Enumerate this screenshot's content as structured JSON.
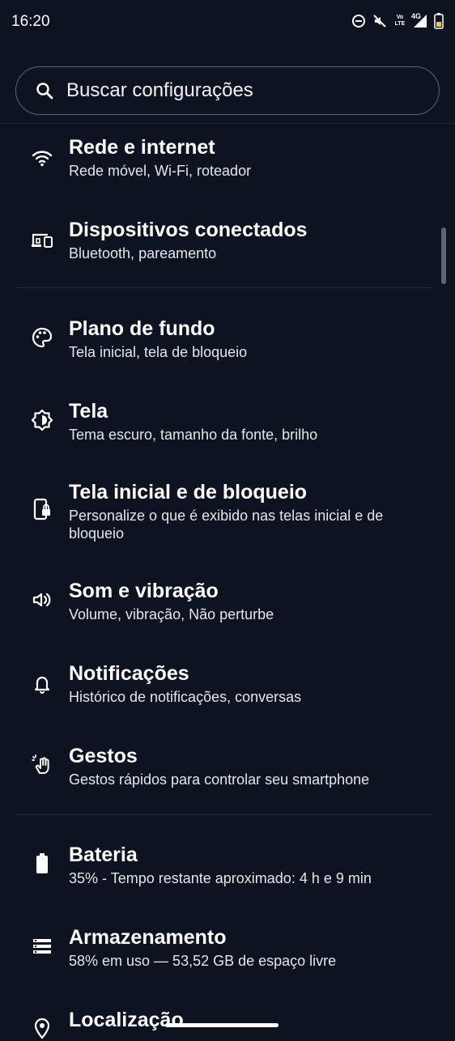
{
  "status_bar": {
    "time": "16:20",
    "icons": [
      "do-not-disturb-icon",
      "muted-icon",
      "volte-icon",
      "4g-signal-icon",
      "battery-icon"
    ],
    "volte_label": "Vo LTE",
    "network_label": "4G"
  },
  "search": {
    "placeholder": "Buscar configurações"
  },
  "settings": [
    {
      "icon": "wifi-icon",
      "title": "Rede e internet",
      "subtitle": "Rede móvel, Wi-Fi, roteador"
    },
    {
      "icon": "connected-devices-icon",
      "title": "Dispositivos conectados",
      "subtitle": "Bluetooth, pareamento"
    },
    {
      "icon": "palette-icon",
      "title": "Plano de fundo",
      "subtitle": "Tela inicial, tela de bloqueio"
    },
    {
      "icon": "brightness-icon",
      "title": "Tela",
      "subtitle": "Tema escuro, tamanho da fonte, brilho"
    },
    {
      "icon": "phone-lock-icon",
      "title": "Tela inicial e de bloqueio",
      "subtitle": "Personalize o que é exibido nas telas inicial e de bloqueio"
    },
    {
      "icon": "volume-icon",
      "title": "Som e vibração",
      "subtitle": "Volume, vibração, Não perturbe"
    },
    {
      "icon": "bell-icon",
      "title": "Notificações",
      "subtitle": "Histórico de notificações, conversas"
    },
    {
      "icon": "gesture-icon",
      "title": "Gestos",
      "subtitle": "Gestos rápidos para controlar seu smartphone"
    },
    {
      "icon": "battery-icon",
      "title": "Bateria",
      "subtitle": "35% - Tempo restante aproximado: 4 h e 9 min"
    },
    {
      "icon": "storage-icon",
      "title": "Armazenamento",
      "subtitle": "58% em uso — 53,52 GB de espaço livre"
    },
    {
      "icon": "location-icon",
      "title": "Localização",
      "subtitle": ""
    }
  ],
  "colors": {
    "background": "#0d1321",
    "text": "#ffffff",
    "subtext": "#e4e6ea",
    "divider": "#232a38"
  }
}
